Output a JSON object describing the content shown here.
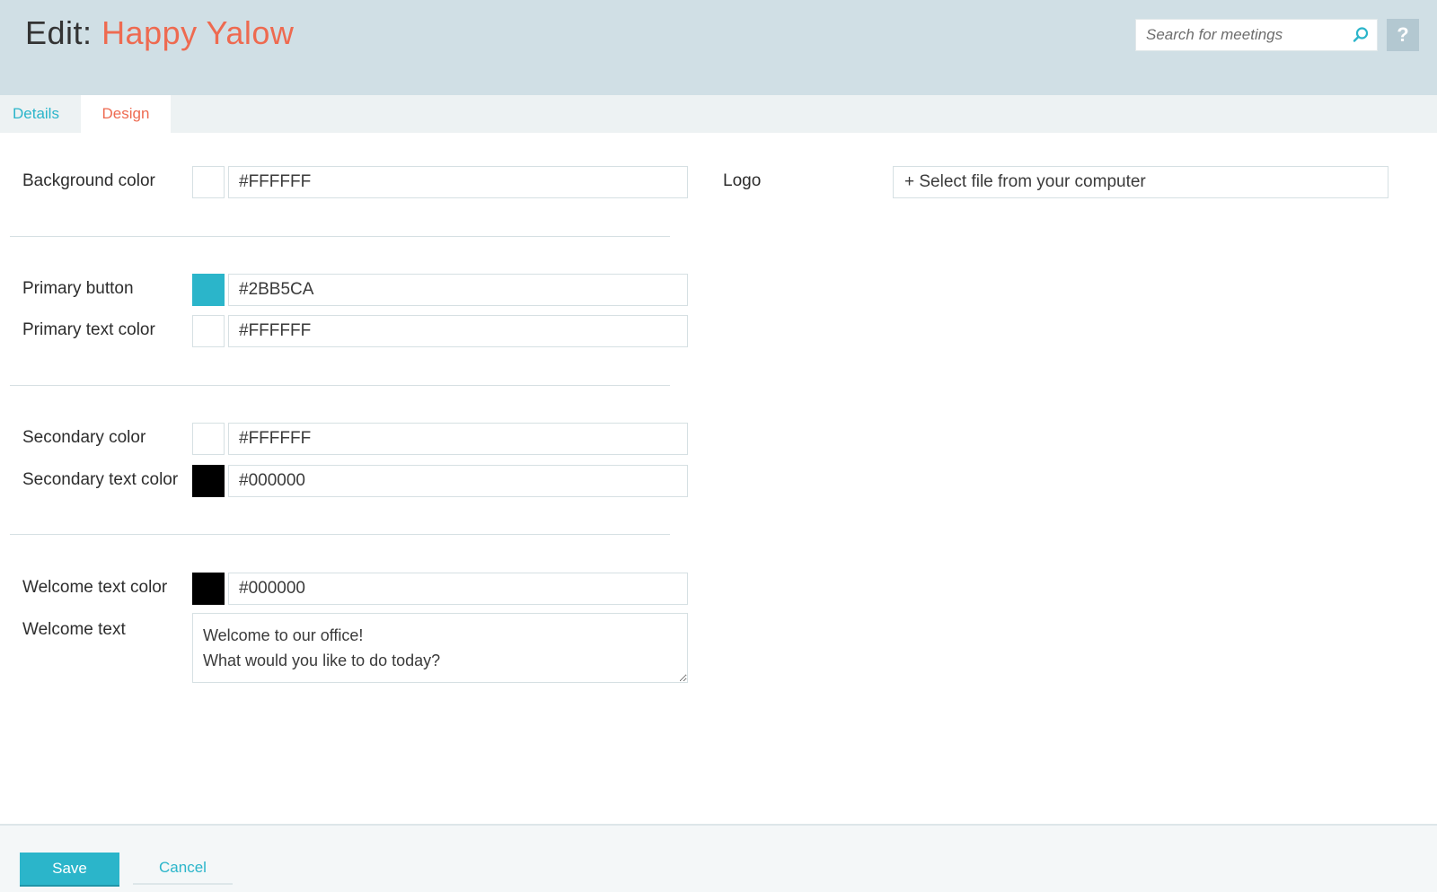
{
  "header": {
    "title_prefix": "Edit:",
    "title_name": "Happy Yalow",
    "search_placeholder": "Search for meetings",
    "help_label": "?"
  },
  "tabs": [
    {
      "label": "Details",
      "active": false
    },
    {
      "label": "Design",
      "active": true
    }
  ],
  "design": {
    "background": {
      "label": "Background color",
      "value": "#FFFFFF",
      "swatch": "#ffffff"
    },
    "primary_button": {
      "label": "Primary button",
      "value": "#2BB5CA",
      "swatch": "#2bb5ca"
    },
    "primary_text": {
      "label": "Primary text color",
      "value": "#FFFFFF",
      "swatch": "#ffffff"
    },
    "secondary": {
      "label": "Secondary color",
      "value": "#FFFFFF",
      "swatch": "#ffffff"
    },
    "secondary_text": {
      "label": "Secondary text color",
      "value": "#000000",
      "swatch": "#000000"
    },
    "welcome_color": {
      "label": "Welcome text color",
      "value": "#000000",
      "swatch": "#000000"
    },
    "welcome_text": {
      "label": "Welcome text",
      "value": "Welcome to our office!\nWhat would you like to do today?"
    },
    "logo": {
      "label": "Logo",
      "button_label": "+ Select file from your computer"
    }
  },
  "footer": {
    "save_label": "Save",
    "cancel_label": "Cancel"
  },
  "colors": {
    "accent": "#2bb5ca",
    "title_highlight": "#ee6a50",
    "header_bg": "#d0dfe5"
  }
}
